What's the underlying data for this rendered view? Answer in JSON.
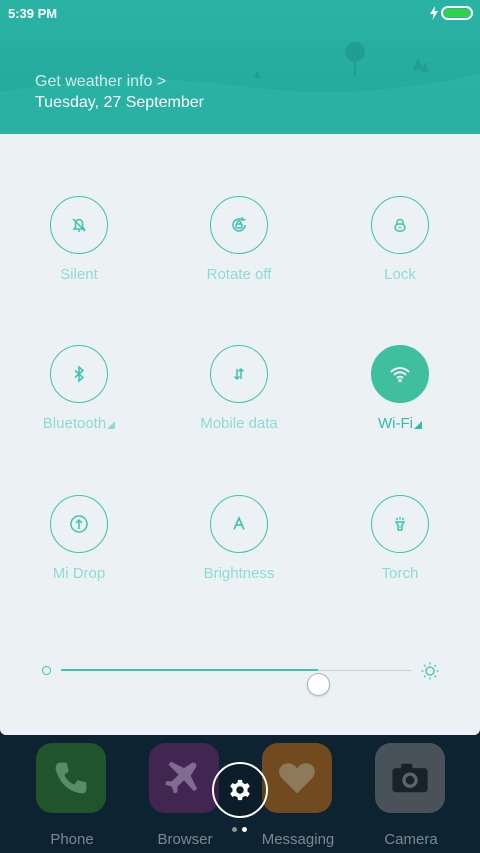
{
  "status_bar": {
    "time": "5:39 PM",
    "battery_level": 1.0
  },
  "header": {
    "weather_link": "Get weather info >",
    "date": "Tuesday, 27 September"
  },
  "toggles": [
    {
      "label": "Silent",
      "icon": "silent-icon",
      "active": false,
      "has_menu": false
    },
    {
      "label": "Rotate off",
      "icon": "rotate-lock-icon",
      "active": false,
      "has_menu": false
    },
    {
      "label": "Lock",
      "icon": "lock-icon",
      "active": false,
      "has_menu": false
    },
    {
      "label": "Bluetooth",
      "icon": "bluetooth-icon",
      "active": false,
      "has_menu": true
    },
    {
      "label": "Mobile data",
      "icon": "mobile-data-icon",
      "active": false,
      "has_menu": false
    },
    {
      "label": "Wi-Fi",
      "icon": "wifi-icon",
      "active": true,
      "has_menu": true
    },
    {
      "label": "Mi Drop",
      "icon": "mi-drop-icon",
      "active": false,
      "has_menu": false
    },
    {
      "label": "Brightness",
      "icon": "brightness-auto-icon",
      "active": false,
      "has_menu": false
    },
    {
      "label": "Torch",
      "icon": "torch-icon",
      "active": false,
      "has_menu": false
    }
  ],
  "brightness": {
    "level": 0.735
  },
  "dock": {
    "apps": [
      {
        "label": "Phone",
        "icon": "phone-icon",
        "color": "#2f7d2a"
      },
      {
        "label": "Browser",
        "icon": "airplane-icon",
        "color": "#6b2a6a"
      },
      {
        "label": "Messaging",
        "icon": "heart-icon",
        "color": "#c36a12"
      },
      {
        "label": "Camera",
        "icon": "camera-icon",
        "color": "#7a7a7a"
      }
    ],
    "settings_icon": "gear-icon",
    "page_indicator": {
      "pages": 2,
      "current": 2
    }
  },
  "colors": {
    "accent": "#3fc1ad",
    "header": "#26ab9e",
    "panel": "#ecf2f4",
    "active_toggle": "#3fbf9d"
  }
}
